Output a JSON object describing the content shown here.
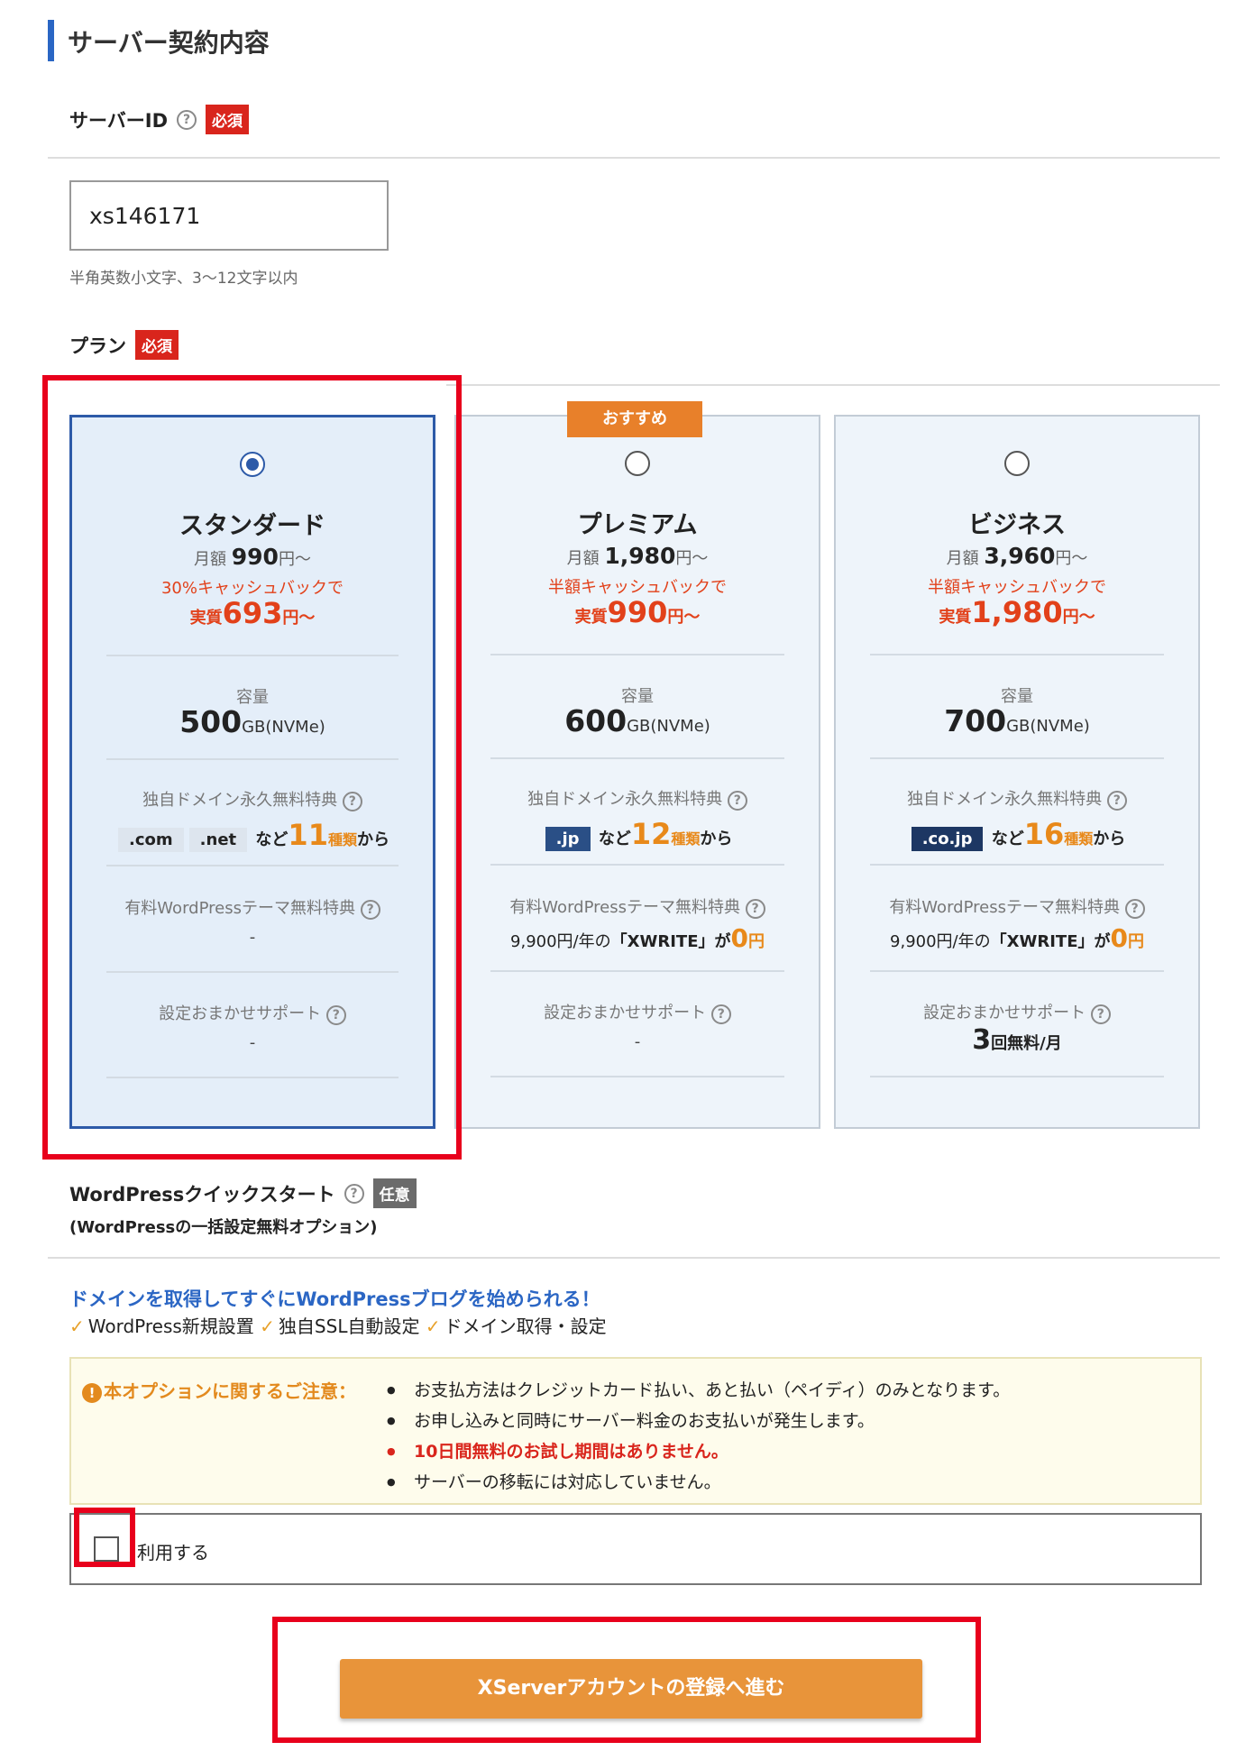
{
  "section_title": "サーバー契約内容",
  "server_id": {
    "label": "サーバーID",
    "required": "必須",
    "value": "xs146171",
    "hint": "半角英数小文字、3〜12文字以内"
  },
  "plan": {
    "label": "プラン",
    "required": "必須",
    "recommended_badge": "おすすめ",
    "items": [
      {
        "name": "スタンダード",
        "price_prefix": "月額",
        "price": "990",
        "price_suffix": "円〜",
        "cashback": "30%キャッシュバックで",
        "real_prefix": "実質",
        "real_price": "693",
        "real_suffix": "円〜",
        "capacity_label": "容量",
        "capacity": "500",
        "capacity_unit": "GB(NVMe)",
        "domain_label": "独自ドメイン永久無料特典",
        "tlds": [
          ".com",
          ".net"
        ],
        "domain_prefix": "など",
        "domain_count": "11",
        "domain_unit": "種類",
        "domain_suffix": "から",
        "theme_label": "有料WordPressテーマ無料特典",
        "theme_value": "-",
        "support_label": "設定おまかせサポート",
        "support_value": "-",
        "selected": true
      },
      {
        "name": "プレミアム",
        "price_prefix": "月額",
        "price": "1,980",
        "price_suffix": "円〜",
        "cashback": "半額キャッシュバックで",
        "real_prefix": "実質",
        "real_price": "990",
        "real_suffix": "円〜",
        "capacity_label": "容量",
        "capacity": "600",
        "capacity_unit": "GB(NVMe)",
        "domain_label": "独自ドメイン永久無料特典",
        "tlds": [
          ".jp"
        ],
        "domain_prefix": "など",
        "domain_count": "12",
        "domain_unit": "種類",
        "domain_suffix": "から",
        "theme_label": "有料WordPressテーマ無料特典",
        "theme_price": "9,900円/年の",
        "theme_name": "「XWRITE」",
        "theme_ga": "が",
        "theme_zero": "0",
        "theme_yen": "円",
        "support_label": "設定おまかせサポート",
        "support_value": "-",
        "selected": false
      },
      {
        "name": "ビジネス",
        "price_prefix": "月額",
        "price": "3,960",
        "price_suffix": "円〜",
        "cashback": "半額キャッシュバックで",
        "real_prefix": "実質",
        "real_price": "1,980",
        "real_suffix": "円〜",
        "capacity_label": "容量",
        "capacity": "700",
        "capacity_unit": "GB(NVMe)",
        "domain_label": "独自ドメイン永久無料特典",
        "tlds": [
          ".co.jp"
        ],
        "domain_prefix": "など",
        "domain_count": "16",
        "domain_unit": "種類",
        "domain_suffix": "から",
        "theme_label": "有料WordPressテーマ無料特典",
        "theme_price": "9,900円/年の",
        "theme_name": "「XWRITE」",
        "theme_ga": "が",
        "theme_zero": "0",
        "theme_yen": "円",
        "support_label": "設定おまかせサポート",
        "support_num": "3",
        "support_unit": "回無料/月",
        "selected": false
      }
    ]
  },
  "wp_quickstart": {
    "title": "WordPressクイックスタート",
    "optional": "任意",
    "subtitle": "(WordPressの一括設定無料オプション)",
    "promo": "ドメインを取得してすぐにWordPressブログを始められる！",
    "features": [
      "WordPress新規設置",
      "独自SSL自動設定",
      "ドメイン取得・設定"
    ],
    "notice_title": "本オプションに関するご注意：",
    "notices": [
      "お支払方法はクレジットカード払い、あと払い（ペイディ）のみとなります。",
      "お申し込みと同時にサーバー料金のお支払いが発生します。",
      "10日間無料のお試し期間はありません。",
      "サーバーの移転には対応していません。"
    ],
    "use_label": "利用する",
    "use_checked": false
  },
  "help_glyph": "?",
  "check_glyph": "✓",
  "notice_icon": "!",
  "submit_label": "XServerアカウントの登録へ進む",
  "colors": {
    "accent_blue": "#2a66c4",
    "required_red": "#d9251c",
    "orange": "#e8943a",
    "highlight_red": "#e8001c"
  }
}
